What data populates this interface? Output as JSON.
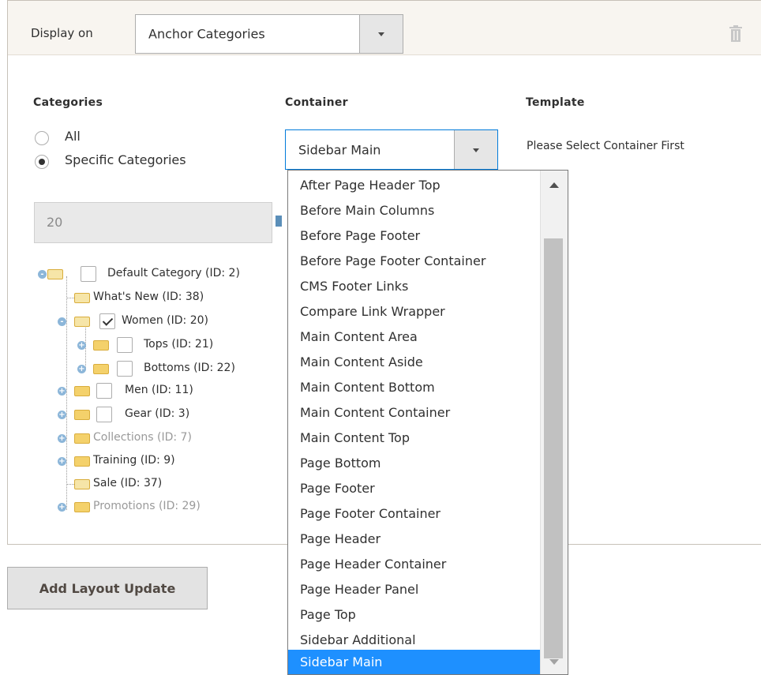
{
  "header": {
    "display_label": "Display on",
    "display_value": "Anchor Categories"
  },
  "columns": {
    "categories": "Categories",
    "container": "Container",
    "template": "Template"
  },
  "categories": {
    "option_all": "All",
    "option_specific": "Specific Categories",
    "selected_option": "Specific Categories",
    "input_value": "20",
    "tree": [
      {
        "label": "Default Category (ID: 2)",
        "checked": false
      },
      {
        "label": "What's New (ID: 38)"
      },
      {
        "label": "Women (ID: 20)",
        "checked": true
      },
      {
        "label": "Tops (ID: 21)",
        "checked": false
      },
      {
        "label": "Bottoms (ID: 22)",
        "checked": false
      },
      {
        "label": "Men (ID: 11)",
        "checked": false
      },
      {
        "label": "Gear (ID: 3)",
        "checked": false
      },
      {
        "label": "Collections (ID: 7)"
      },
      {
        "label": "Training (ID: 9)"
      },
      {
        "label": "Sale (ID: 37)"
      },
      {
        "label": "Promotions (ID: 29)"
      }
    ]
  },
  "container": {
    "selected": "Sidebar Main",
    "options": [
      "After Page Header Top",
      "Before Main Columns",
      "Before Page Footer",
      "Before Page Footer Container",
      "CMS Footer Links",
      "Compare Link Wrapper",
      "Main Content Area",
      "Main Content Aside",
      "Main Content Bottom",
      "Main Content Container",
      "Main Content Top",
      "Page Bottom",
      "Page Footer",
      "Page Footer Container",
      "Page Header",
      "Page Header Container",
      "Page Header Panel",
      "Page Top",
      "Sidebar Additional",
      "Sidebar Main"
    ]
  },
  "template": {
    "message": "Please Select Container First"
  },
  "actions": {
    "add_layout_update": "Add Layout Update"
  },
  "colors": {
    "highlight": "#1e90ff",
    "panel_header": "#f8f5f0"
  },
  "icons": {
    "delete": "trash-icon",
    "expand": "plus-circle-icon",
    "folder": "folder-icon",
    "chooser": "chooser-icon"
  }
}
